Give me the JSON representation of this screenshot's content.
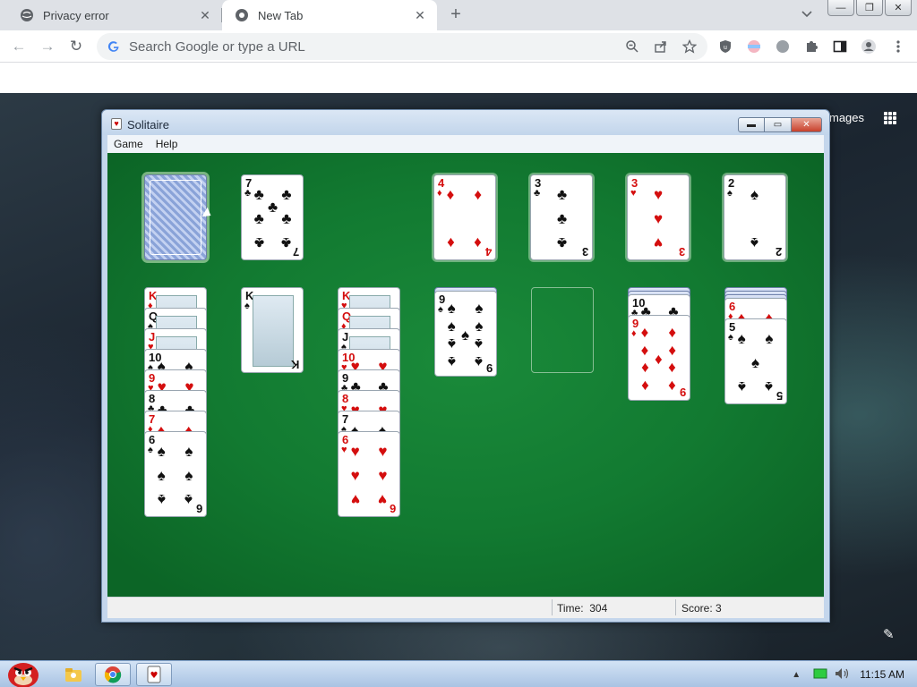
{
  "browser": {
    "tabs": [
      {
        "title": "Privacy error",
        "close_glyph": "✕"
      },
      {
        "title": "New Tab",
        "close_glyph": "✕"
      }
    ],
    "newtab_glyph": "+",
    "omnibox_placeholder": "Search Google or type a URL",
    "window_controls": [
      "—",
      "❐",
      "✕"
    ]
  },
  "newtab_page": {
    "images_label": "mages"
  },
  "solitaire": {
    "title": "Solitaire",
    "menu": [
      "Game",
      "Help"
    ],
    "window_controls": [
      "▬",
      "▭",
      "✕"
    ],
    "status": {
      "time_label": "Time:",
      "time_value": "304",
      "score_label": "Score:",
      "score_value": "3"
    },
    "waste_card": {
      "rank": "7",
      "suit": "♣",
      "color": "black"
    },
    "foundations": [
      {
        "rank": "4",
        "suit": "♦",
        "color": "red"
      },
      {
        "rank": "3",
        "suit": "♣",
        "color": "black"
      },
      {
        "rank": "3",
        "suit": "♥",
        "color": "red"
      },
      {
        "rank": "2",
        "suit": "♠",
        "color": "black"
      }
    ],
    "tableau": [
      {
        "hidden": 0,
        "cards": [
          {
            "rank": "K",
            "suit": "♦",
            "color": "red"
          },
          {
            "rank": "Q",
            "suit": "♠",
            "color": "black"
          },
          {
            "rank": "J",
            "suit": "♥",
            "color": "red"
          },
          {
            "rank": "10",
            "suit": "♠",
            "color": "black"
          },
          {
            "rank": "9",
            "suit": "♥",
            "color": "red"
          },
          {
            "rank": "8",
            "suit": "♣",
            "color": "black"
          },
          {
            "rank": "7",
            "suit": "♦",
            "color": "red"
          },
          {
            "rank": "6",
            "suit": "♠",
            "color": "black"
          }
        ]
      },
      {
        "hidden": 0,
        "cards": [
          {
            "rank": "K",
            "suit": "♠",
            "color": "black"
          }
        ]
      },
      {
        "hidden": 0,
        "cards": [
          {
            "rank": "K",
            "suit": "♥",
            "color": "red"
          },
          {
            "rank": "Q",
            "suit": "♦",
            "color": "red"
          },
          {
            "rank": "J",
            "suit": "♠",
            "color": "black"
          },
          {
            "rank": "10",
            "suit": "♥",
            "color": "red"
          },
          {
            "rank": "9",
            "suit": "♣",
            "color": "black"
          },
          {
            "rank": "8",
            "suit": "♥",
            "color": "red"
          },
          {
            "rank": "7",
            "suit": "♠",
            "color": "black"
          },
          {
            "rank": "6",
            "suit": "♥",
            "color": "red"
          }
        ]
      },
      {
        "hidden": 1,
        "cards": [
          {
            "rank": "9",
            "suit": "♠",
            "color": "black"
          }
        ]
      },
      {
        "hidden": 0,
        "cards": []
      },
      {
        "hidden": 2,
        "cards": [
          {
            "rank": "10",
            "suit": "♣",
            "color": "black"
          },
          {
            "rank": "9",
            "suit": "♦",
            "color": "red"
          }
        ]
      },
      {
        "hidden": 3,
        "cards": [
          {
            "rank": "6",
            "suit": "♦",
            "color": "red"
          },
          {
            "rank": "5",
            "suit": "♠",
            "color": "black"
          }
        ]
      }
    ]
  },
  "taskbar": {
    "clock": "11:15 AM"
  },
  "colors": {
    "felt": "#127a31",
    "red_suit": "#d40e0e",
    "black_suit": "#111111",
    "taskbar": "#bcd3ee"
  }
}
